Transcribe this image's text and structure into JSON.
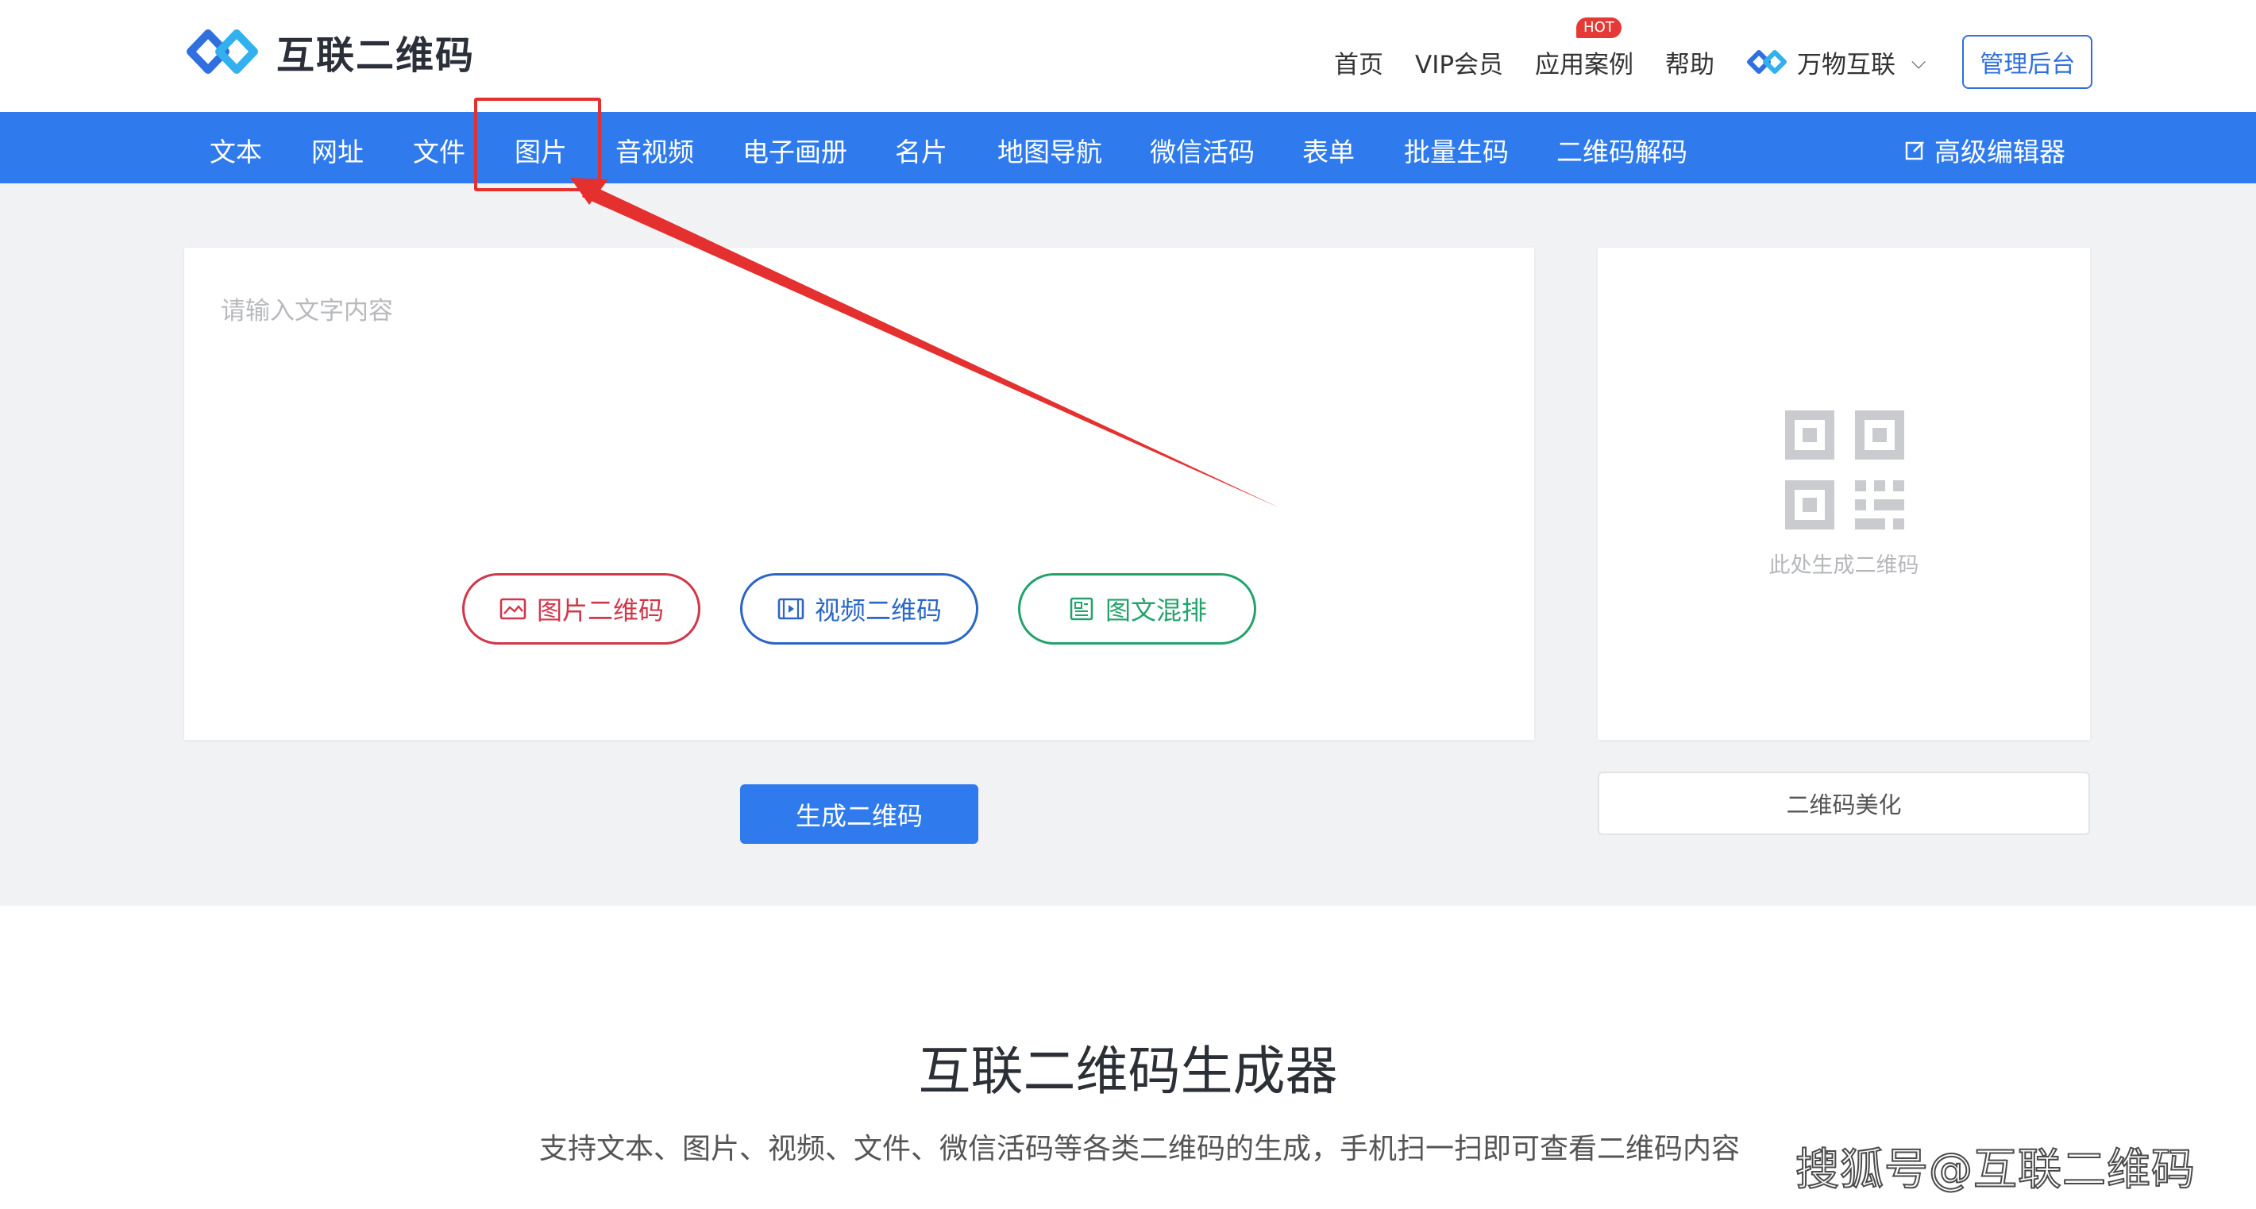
{
  "header": {
    "logo_text": "互联二维码",
    "nav": [
      {
        "label": "首页"
      },
      {
        "label": "VIP会员"
      },
      {
        "label": "应用案例",
        "badge": "HOT"
      },
      {
        "label": "帮助"
      }
    ],
    "brand_dropdown": "万物互联",
    "admin_button": "管理后台"
  },
  "tabs": [
    {
      "label": "文本"
    },
    {
      "label": "网址"
    },
    {
      "label": "文件"
    },
    {
      "label": "图片"
    },
    {
      "label": "音视频"
    },
    {
      "label": "电子画册"
    },
    {
      "label": "名片"
    },
    {
      "label": "地图导航"
    },
    {
      "label": "微信活码"
    },
    {
      "label": "表单"
    },
    {
      "label": "批量生码"
    },
    {
      "label": "二维码解码"
    }
  ],
  "advanced_editor": "高级编辑器",
  "editor": {
    "placeholder": "请输入文字内容",
    "value": ""
  },
  "insert_buttons": [
    {
      "label": "图片二维码"
    },
    {
      "label": "视频二维码"
    },
    {
      "label": "图文混排"
    }
  ],
  "generate_button": "生成二维码",
  "preview": {
    "text": "此处生成二维码"
  },
  "beautify_button": "二维码美化",
  "section": {
    "title": "互联二维码生成器",
    "subtitle": "支持文本、图片、视频、文件、微信活码等各类二维码的生成，手机扫一扫即可查看二维码内容"
  },
  "watermark": "搜狐号@互联二维码",
  "colors": {
    "brand_blue": "#2f7bed",
    "annotation_red": "#e53030",
    "pill_red": "#d0374a",
    "pill_blue": "#2a66c6",
    "pill_green": "#23a36b"
  }
}
